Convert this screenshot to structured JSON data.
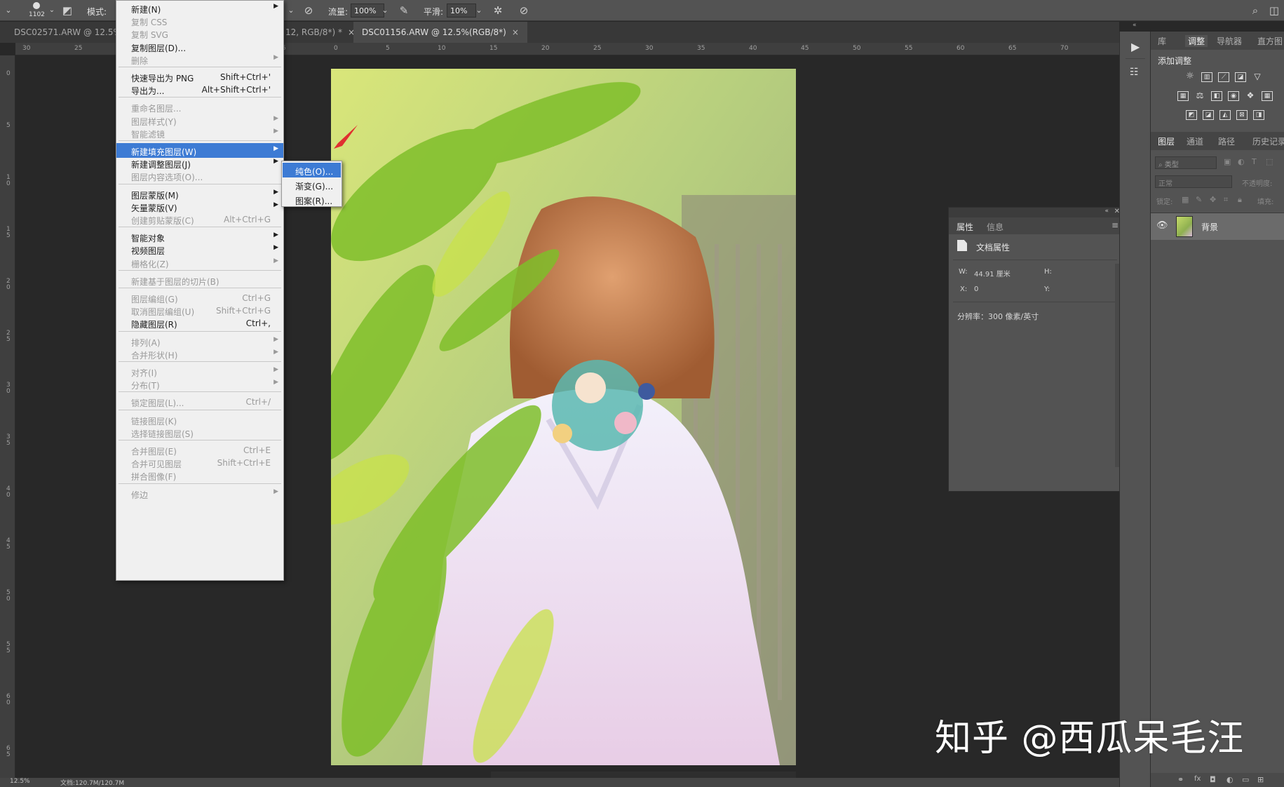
{
  "options_bar": {
    "brush_size": "1102",
    "mode_label": "模式:",
    "flow_label": "流量:",
    "flow_value": "100%",
    "smooth_label": "平滑:",
    "smooth_value": "10%"
  },
  "tabs": [
    {
      "label": "DSC02571.ARW @ 12.5%(R",
      "active": false
    },
    {
      "label": "12, RGB/8*) *",
      "active": false
    },
    {
      "label": "DSC01156.ARW @ 12.5%(RGB/8*)",
      "active": true
    }
  ],
  "tab_close_glyph": "×",
  "ruler": {
    "top": [
      "30",
      "25",
      "20",
      "15",
      "10",
      "5",
      "0",
      "5",
      "10",
      "15",
      "20",
      "25",
      "30",
      "35",
      "40",
      "45",
      "50",
      "55",
      "60",
      "65",
      "70"
    ],
    "left": [
      "0",
      "5",
      "1\n0",
      "1\n5",
      "2\n0",
      "2\n5",
      "3\n0",
      "3\n5",
      "4\n0",
      "4\n5",
      "5\n0",
      "5\n5",
      "6\n0",
      "6\n5"
    ]
  },
  "layer_menu": {
    "items": [
      {
        "label": "新建(N)",
        "shortcut": "",
        "submenu": true,
        "disabled": false
      },
      {
        "label": "复制 CSS",
        "shortcut": "",
        "submenu": false,
        "disabled": true
      },
      {
        "label": "复制 SVG",
        "shortcut": "",
        "submenu": false,
        "disabled": true
      },
      {
        "label": "复制图层(D)...",
        "shortcut": "",
        "submenu": false,
        "disabled": false
      },
      {
        "label": "删除",
        "shortcut": "",
        "submenu": true,
        "disabled": true
      },
      {
        "sep": true
      },
      {
        "label": "快速导出为 PNG",
        "shortcut": "Shift+Ctrl+'",
        "submenu": false,
        "disabled": false
      },
      {
        "label": "导出为...",
        "shortcut": "Alt+Shift+Ctrl+'",
        "submenu": false,
        "disabled": false
      },
      {
        "sep": true
      },
      {
        "label": "重命名图层...",
        "shortcut": "",
        "submenu": false,
        "disabled": true
      },
      {
        "label": "图层样式(Y)",
        "shortcut": "",
        "submenu": true,
        "disabled": true
      },
      {
        "label": "智能滤镜",
        "shortcut": "",
        "submenu": true,
        "disabled": true
      },
      {
        "sep": true
      },
      {
        "label": "新建填充图层(W)",
        "shortcut": "",
        "submenu": true,
        "disabled": false,
        "highlighted": true
      },
      {
        "label": "新建调整图层(J)",
        "shortcut": "",
        "submenu": true,
        "disabled": false
      },
      {
        "label": "图层内容选项(O)...",
        "shortcut": "",
        "submenu": false,
        "disabled": true
      },
      {
        "sep": true
      },
      {
        "label": "图层蒙版(M)",
        "shortcut": "",
        "submenu": true,
        "disabled": false
      },
      {
        "label": "矢量蒙版(V)",
        "shortcut": "",
        "submenu": true,
        "disabled": false
      },
      {
        "label": "创建剪贴蒙版(C)",
        "shortcut": "Alt+Ctrl+G",
        "submenu": false,
        "disabled": true
      },
      {
        "sep": true
      },
      {
        "label": "智能对象",
        "shortcut": "",
        "submenu": true,
        "disabled": false
      },
      {
        "label": "视频图层",
        "shortcut": "",
        "submenu": true,
        "disabled": false
      },
      {
        "label": "栅格化(Z)",
        "shortcut": "",
        "submenu": true,
        "disabled": true
      },
      {
        "sep": true
      },
      {
        "label": "新建基于图层的切片(B)",
        "shortcut": "",
        "submenu": false,
        "disabled": true
      },
      {
        "sep": true
      },
      {
        "label": "图层编组(G)",
        "shortcut": "Ctrl+G",
        "submenu": false,
        "disabled": true
      },
      {
        "label": "取消图层编组(U)",
        "shortcut": "Shift+Ctrl+G",
        "submenu": false,
        "disabled": true
      },
      {
        "label": "隐藏图层(R)",
        "shortcut": "Ctrl+,",
        "submenu": false,
        "disabled": false
      },
      {
        "sep": true
      },
      {
        "label": "排列(A)",
        "shortcut": "",
        "submenu": true,
        "disabled": true
      },
      {
        "label": "合并形状(H)",
        "shortcut": "",
        "submenu": true,
        "disabled": true
      },
      {
        "sep": true
      },
      {
        "label": "对齐(I)",
        "shortcut": "",
        "submenu": true,
        "disabled": true
      },
      {
        "label": "分布(T)",
        "shortcut": "",
        "submenu": true,
        "disabled": true
      },
      {
        "sep": true
      },
      {
        "label": "锁定图层(L)...",
        "shortcut": "Ctrl+/",
        "submenu": false,
        "disabled": true
      },
      {
        "sep": true
      },
      {
        "label": "链接图层(K)",
        "shortcut": "",
        "submenu": false,
        "disabled": true
      },
      {
        "label": "选择链接图层(S)",
        "shortcut": "",
        "submenu": false,
        "disabled": true
      },
      {
        "sep": true
      },
      {
        "label": "合并图层(E)",
        "shortcut": "Ctrl+E",
        "submenu": false,
        "disabled": true
      },
      {
        "label": "合并可见图层",
        "shortcut": "Shift+Ctrl+E",
        "submenu": false,
        "disabled": true
      },
      {
        "label": "拼合图像(F)",
        "shortcut": "",
        "submenu": false,
        "disabled": true
      },
      {
        "sep": true
      },
      {
        "label": "修边",
        "shortcut": "",
        "submenu": true,
        "disabled": true
      }
    ]
  },
  "fill_submenu": {
    "items": [
      {
        "label": "纯色(O)...",
        "highlighted": true
      },
      {
        "label": "渐变(G)...",
        "highlighted": false
      },
      {
        "label": "图案(R)...",
        "highlighted": false
      }
    ]
  },
  "properties": {
    "tabs": [
      "属性",
      "信息"
    ],
    "section": "文档属性",
    "w_label": "W:",
    "w_value": "44.91 厘米",
    "h_label": "H:",
    "x_label": "X:",
    "x_value": "0",
    "y_label": "Y:",
    "resolution": "分辨率：300 像素/英寸"
  },
  "right_panel": {
    "top_tabs": [
      "库",
      "调整",
      "导航器",
      "直方图"
    ],
    "active_top": "调整",
    "add_adjustment": "添加调整",
    "layer_tabs": [
      "图层",
      "通道",
      "路径",
      "历史记录"
    ],
    "active_layer_tab": "图层",
    "filter_kind": "类型",
    "blend_mode": "正常",
    "opacity_label": "不透明度:",
    "lock_label": "锁定:",
    "fill_label": "填充:",
    "layer_name": "背景"
  },
  "status": {
    "zoom": "12.5%",
    "doc": "文档:120.7M/120.7M"
  },
  "watermark": "知乎 @西瓜呆毛汪",
  "colors": {
    "menu_highlight": "#3d7bd4",
    "panel_bg": "#535353",
    "canvas_bg": "#282828",
    "arrow": "#e03030"
  }
}
